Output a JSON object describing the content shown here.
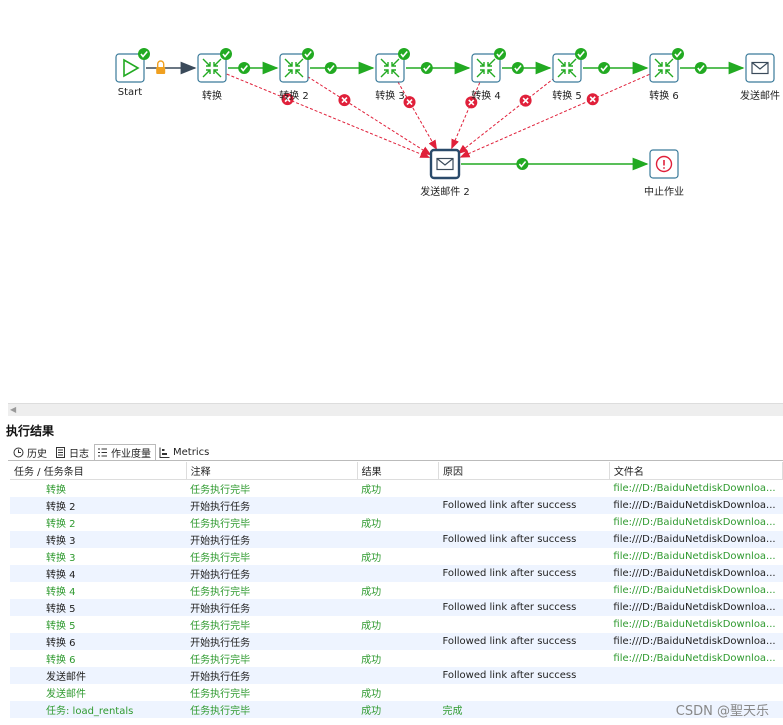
{
  "workflow": {
    "nodes": [
      {
        "id": "start",
        "label": "Start",
        "icon": "play-icon",
        "ok": true
      },
      {
        "id": "t1",
        "label": "转换",
        "icon": "transform-icon",
        "ok": true
      },
      {
        "id": "t2",
        "label": "转换 2",
        "icon": "transform-icon",
        "ok": true
      },
      {
        "id": "t3",
        "label": "转换 3",
        "icon": "transform-icon",
        "ok": true
      },
      {
        "id": "t4",
        "label": "转换 4",
        "icon": "transform-icon",
        "ok": true
      },
      {
        "id": "t5",
        "label": "转换 5",
        "icon": "transform-icon",
        "ok": true
      },
      {
        "id": "t6",
        "label": "转换 6",
        "icon": "transform-icon",
        "ok": true
      },
      {
        "id": "mail1",
        "label": "发送邮件",
        "icon": "mail-icon",
        "ok": false
      },
      {
        "id": "mail2",
        "label": "发送邮件 2",
        "icon": "mail-icon",
        "ok": false
      },
      {
        "id": "abort",
        "label": "中止作业",
        "icon": "abort-icon",
        "ok": false
      }
    ],
    "colors": {
      "success": "#22aa22",
      "failure": "#e0203a",
      "neutral": "#3a4a5a",
      "lock": "#f0a020",
      "node_border": "#3a7a9a"
    }
  },
  "panel": {
    "title": "执行结果",
    "tabs": [
      {
        "label": "历史",
        "icon": "history-icon"
      },
      {
        "label": "日志",
        "icon": "log-icon"
      },
      {
        "label": "作业度量",
        "icon": "metrics-list-icon"
      },
      {
        "label": "Metrics",
        "icon": "chart-icon"
      }
    ],
    "columns": [
      "任务 / 任务条目",
      "注释",
      "结果",
      "原因",
      "文件名"
    ],
    "rows": [
      {
        "cells": [
          "转换",
          "任务执行完毕",
          "成功",
          "",
          "file:///D:/BaiduNetdiskDownloa..."
        ],
        "green": true
      },
      {
        "cells": [
          "转换 2",
          "开始执行任务",
          "",
          "Followed link after success",
          "file:///D:/BaiduNetdiskDownloa..."
        ],
        "green": false
      },
      {
        "cells": [
          "转换 2",
          "任务执行完毕",
          "成功",
          "",
          "file:///D:/BaiduNetdiskDownloa..."
        ],
        "green": true
      },
      {
        "cells": [
          "转换 3",
          "开始执行任务",
          "",
          "Followed link after success",
          "file:///D:/BaiduNetdiskDownloa..."
        ],
        "green": false
      },
      {
        "cells": [
          "转换 3",
          "任务执行完毕",
          "成功",
          "",
          "file:///D:/BaiduNetdiskDownloa..."
        ],
        "green": true
      },
      {
        "cells": [
          "转换 4",
          "开始执行任务",
          "",
          "Followed link after success",
          "file:///D:/BaiduNetdiskDownloa..."
        ],
        "green": false
      },
      {
        "cells": [
          "转换 4",
          "任务执行完毕",
          "成功",
          "",
          "file:///D:/BaiduNetdiskDownloa..."
        ],
        "green": true
      },
      {
        "cells": [
          "转换 5",
          "开始执行任务",
          "",
          "Followed link after success",
          "file:///D:/BaiduNetdiskDownloa..."
        ],
        "green": false
      },
      {
        "cells": [
          "转换 5",
          "任务执行完毕",
          "成功",
          "",
          "file:///D:/BaiduNetdiskDownloa..."
        ],
        "green": true
      },
      {
        "cells": [
          "转换 6",
          "开始执行任务",
          "",
          "Followed link after success",
          "file:///D:/BaiduNetdiskDownloa..."
        ],
        "green": false
      },
      {
        "cells": [
          "转换 6",
          "任务执行完毕",
          "成功",
          "",
          "file:///D:/BaiduNetdiskDownloa..."
        ],
        "green": true
      },
      {
        "cells": [
          "发送邮件",
          "开始执行任务",
          "",
          "Followed link after success",
          ""
        ],
        "green": false
      },
      {
        "cells": [
          "发送邮件",
          "任务执行完毕",
          "成功",
          "",
          ""
        ],
        "green": true
      },
      {
        "cells": [
          "任务: load_rentals",
          "任务执行完毕",
          "成功",
          "完成",
          ""
        ],
        "green": true
      }
    ]
  },
  "watermark": "CSDN @聖天乐"
}
